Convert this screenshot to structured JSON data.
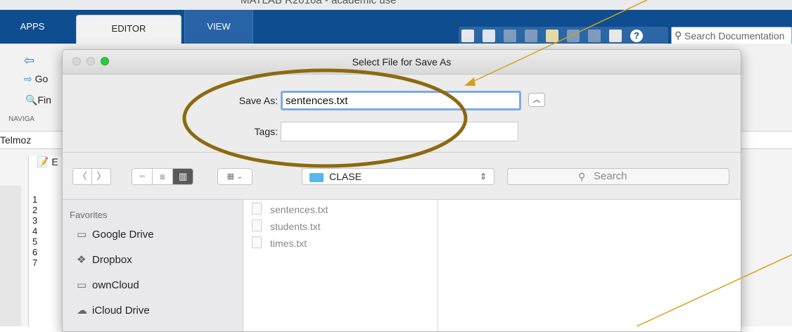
{
  "matlab": {
    "window_title": "MATLAB R2016a - academic use",
    "tabs": [
      {
        "label": "APPS"
      },
      {
        "label": "EDITOR"
      },
      {
        "label": "VIEW"
      }
    ],
    "search_placeholder": "Search Documentation",
    "ribbon": {
      "goto_label": "Go",
      "find_label": "Fin",
      "nav_group": "NAVIGA"
    },
    "path": "Telmoz",
    "editor_tab_label": "E",
    "line_numbers": [
      "1",
      "2",
      "3",
      "4",
      "5",
      "6",
      "7"
    ]
  },
  "dialog": {
    "title": "Select File for Save As",
    "save_as_label": "Save As:",
    "save_as_value": "sentences.txt",
    "tags_label": "Tags:",
    "tags_value": "",
    "location": "CLASE",
    "search_placeholder": "Search",
    "favorites_header": "Favorites",
    "favorites": [
      {
        "label": "Google Drive",
        "icon": "folder-icon"
      },
      {
        "label": "Dropbox",
        "icon": "dropbox-icon"
      },
      {
        "label": "ownCloud",
        "icon": "folder-icon"
      },
      {
        "label": "iCloud Drive",
        "icon": "cloud-icon"
      }
    ],
    "files": [
      {
        "name": "sentences.txt"
      },
      {
        "name": "students.txt"
      },
      {
        "name": "times.txt"
      }
    ]
  },
  "colors": {
    "matlab_blue": "#0e4d8f",
    "annotation": "#8c6a10",
    "arrow": "#d4a017",
    "focus_ring": "#7eabe2"
  }
}
